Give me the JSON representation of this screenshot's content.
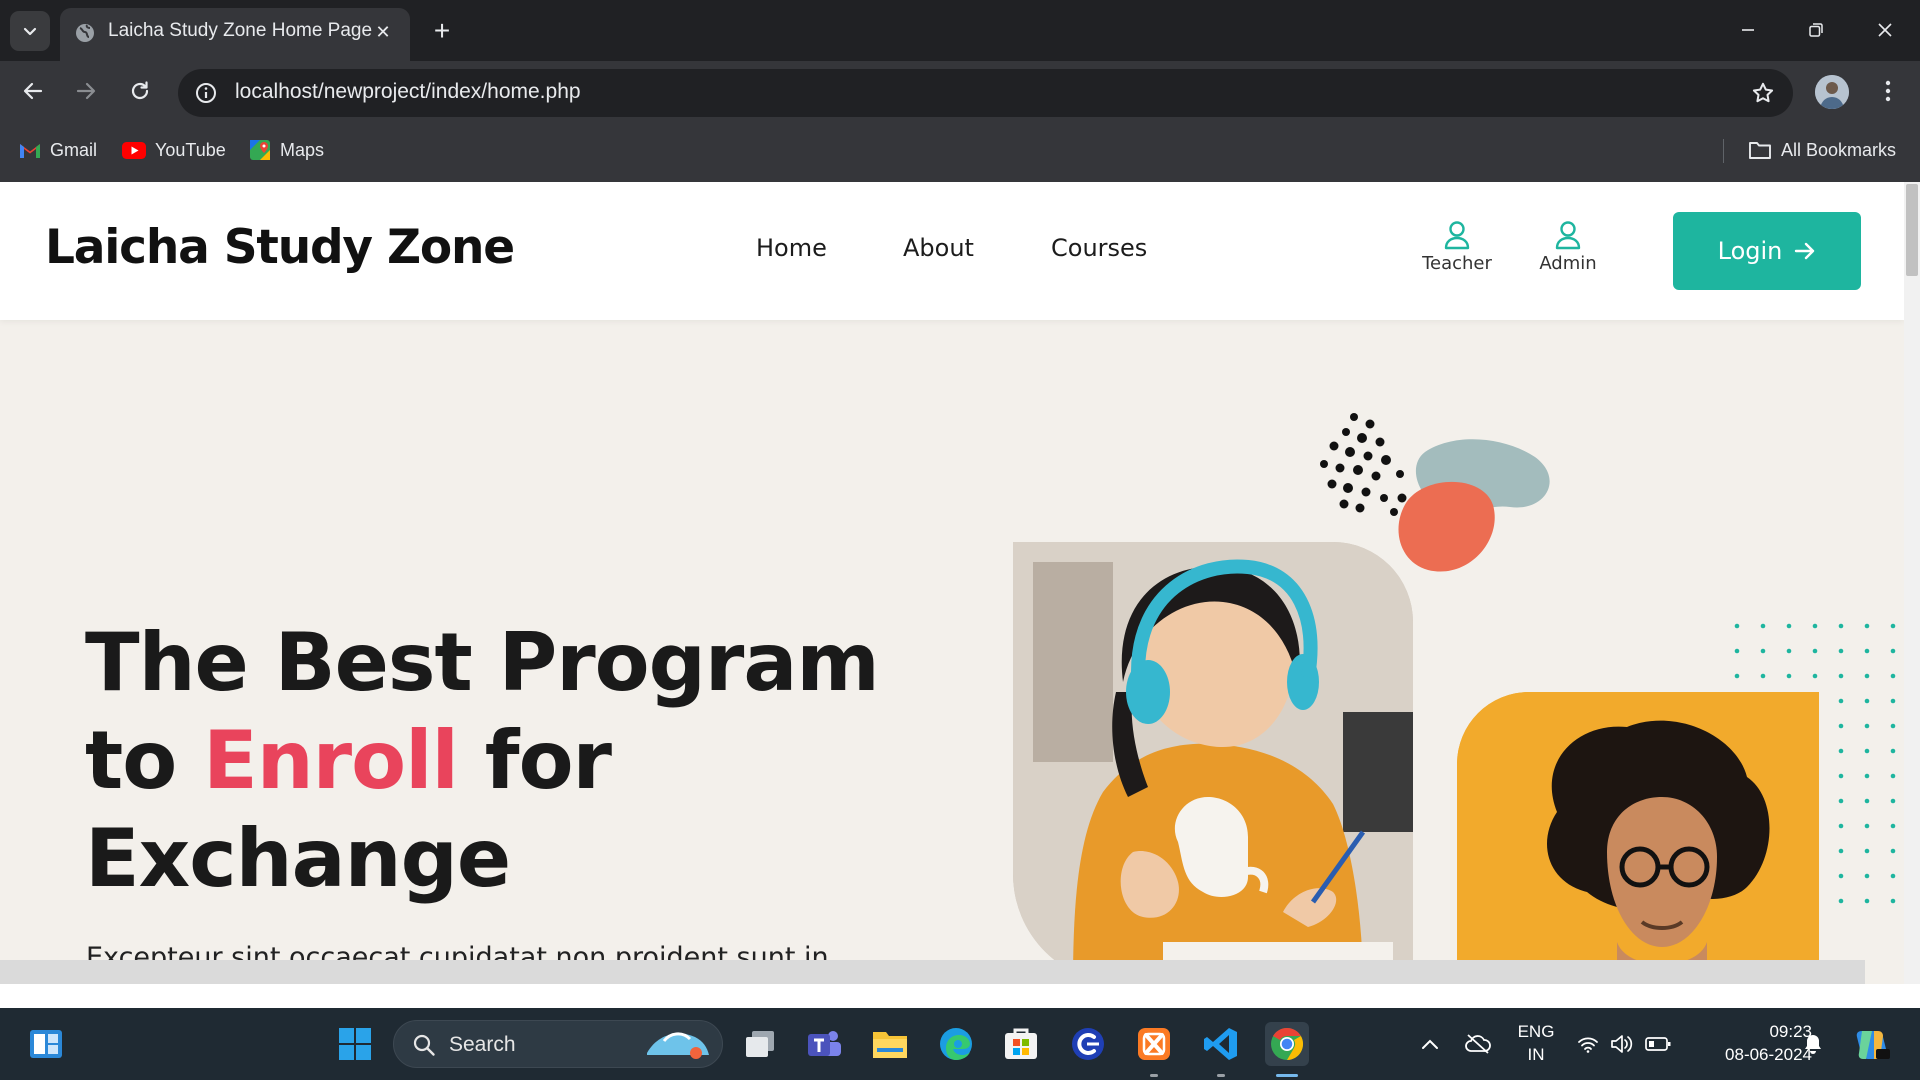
{
  "browser": {
    "tab_title": "Laicha Study Zone Home Page",
    "tab_close": "✕",
    "new_tab": "+",
    "url": "localhost/newproject/index/home.php",
    "bookmarks": [
      {
        "label": "Gmail",
        "icon": "gmail-icon"
      },
      {
        "label": "YouTube",
        "icon": "youtube-icon"
      },
      {
        "label": "Maps",
        "icon": "maps-icon"
      }
    ],
    "all_bookmarks": "All Bookmarks"
  },
  "site": {
    "brand": "Laicha Study Zone",
    "nav": [
      "Home",
      "About",
      "Courses"
    ],
    "roles": [
      {
        "label": "Teacher",
        "icon": "user-icon"
      },
      {
        "label": "Admin",
        "icon": "user-icon"
      }
    ],
    "login": "Login",
    "accent": "#1eb59f",
    "highlight": "#e9445c",
    "hero": {
      "title_line1": "The Best Program",
      "title_to": "to ",
      "title_highlight": "Enroll",
      "title_for": " for",
      "title_line3": "Exchange",
      "text": "Excepteur sint occaecat cupidatat non proident sunt in"
    }
  },
  "taskbar": {
    "search_label": "Search",
    "language": "ENG",
    "region": "IN",
    "time": "09:23",
    "date": "08-06-2024"
  }
}
